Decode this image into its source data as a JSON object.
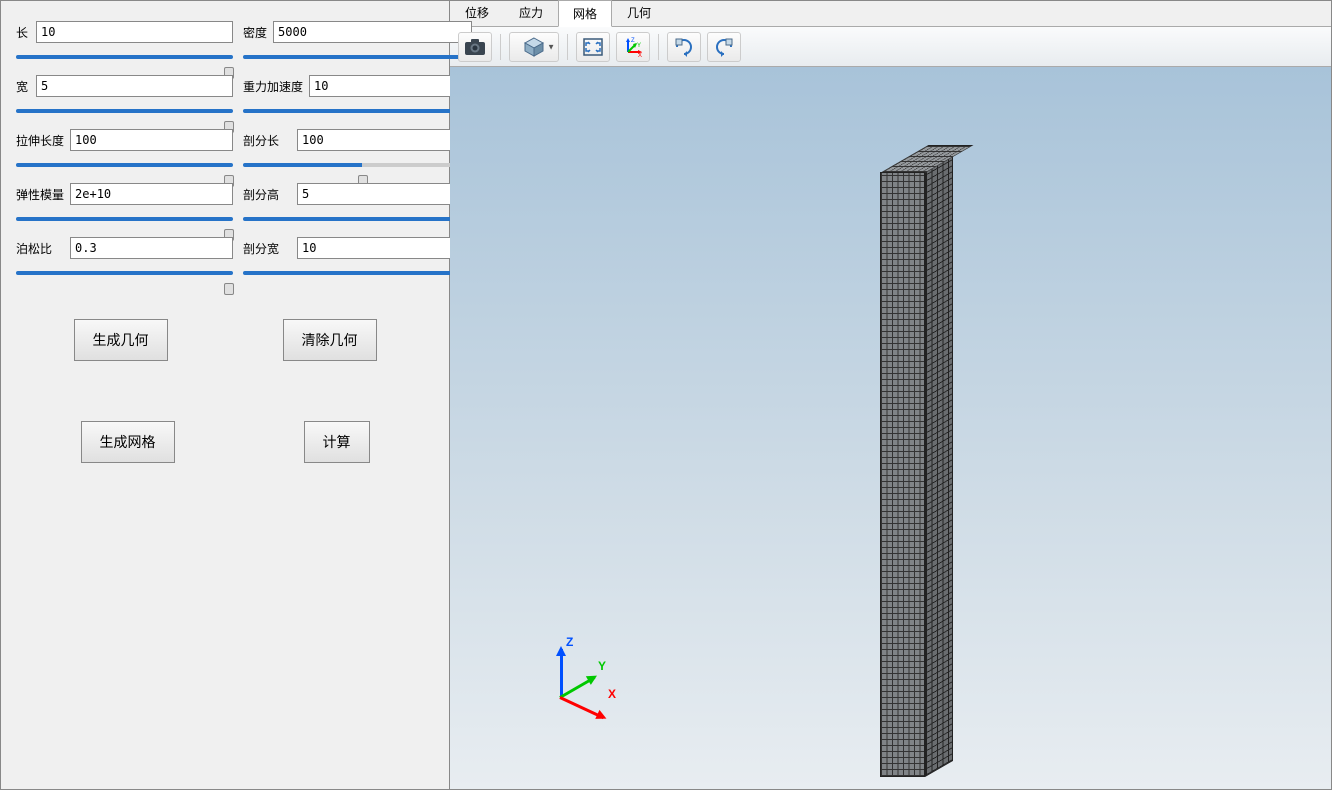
{
  "params": {
    "length": {
      "label": "长",
      "value": "10"
    },
    "density": {
      "label": "密度",
      "value": "5000"
    },
    "width": {
      "label": "宽",
      "value": "5"
    },
    "gravity": {
      "label": "重力加速度",
      "value": "10"
    },
    "extrude": {
      "label": "拉伸长度",
      "value": "100"
    },
    "divL": {
      "label": "剖分长",
      "value": "100"
    },
    "elastic": {
      "label": "弹性模量",
      "value": "2e+10"
    },
    "divH": {
      "label": "剖分高",
      "value": "5"
    },
    "poisson": {
      "label": "泊松比",
      "value": "0.3"
    },
    "divW": {
      "label": "剖分宽",
      "value": "10"
    }
  },
  "buttons": {
    "genGeom": "生成几何",
    "clearGeom": "清除几何",
    "genMesh": "生成网格",
    "compute": "计算"
  },
  "tabs": {
    "displacement": "位移",
    "stress": "应力",
    "mesh": "网格",
    "geometry": "几何",
    "active": "mesh"
  },
  "axes": {
    "x": "X",
    "y": "Y",
    "z": "Z"
  },
  "toolbar": {
    "camera": "camera-icon",
    "cube": "cube-view-icon",
    "fit": "fit-view-icon",
    "orient": "orientation-axes-icon",
    "rotcw": "rotate-cw-icon",
    "rotccw": "rotate-ccw-icon"
  }
}
